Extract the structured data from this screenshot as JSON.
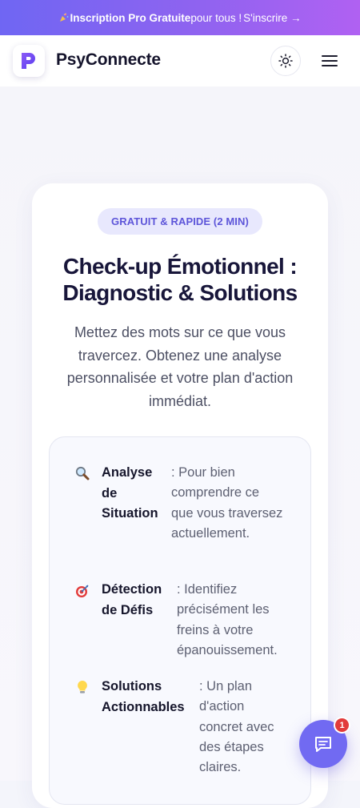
{
  "promo": {
    "highlight": "Inscription Pro Gratuite",
    "text": " pour tous !",
    "cta": "S'inscrire →"
  },
  "header": {
    "brand_name": "PsyConnecte",
    "theme_icon": "sun-icon",
    "menu_icon": "hamburger-menu-icon"
  },
  "hero": {
    "tag": "GRATUIT & RAPIDE (2 MIN)",
    "title_line1": "Check-up Émotionnel :",
    "title_line2": "Diagnostic & Solutions",
    "subtitle": "Mettez des mots sur ce que vous travercez. Obtenez une analyse personnalisée et votre plan d'action immédiat."
  },
  "features": [
    {
      "icon": "magnifier-icon",
      "title": "Analyse de Situation",
      "description": ": Pour bien comprendre ce que vous traversez actuellement."
    },
    {
      "icon": "target-icon",
      "title": "Détection de Défis",
      "description": ": Identifiez précisément les freins à votre épanouissement."
    },
    {
      "icon": "lightbulb-icon",
      "title": "Solutions Actionnables",
      "description": ": Un plan d'action concret avec des étapes claires."
    }
  ],
  "chat": {
    "icon": "chat-icon",
    "badge_count": "1"
  },
  "colors": {
    "accent": "#6f66f3",
    "brand_dark": "#18163a",
    "badge_red": "#e23b3b"
  }
}
